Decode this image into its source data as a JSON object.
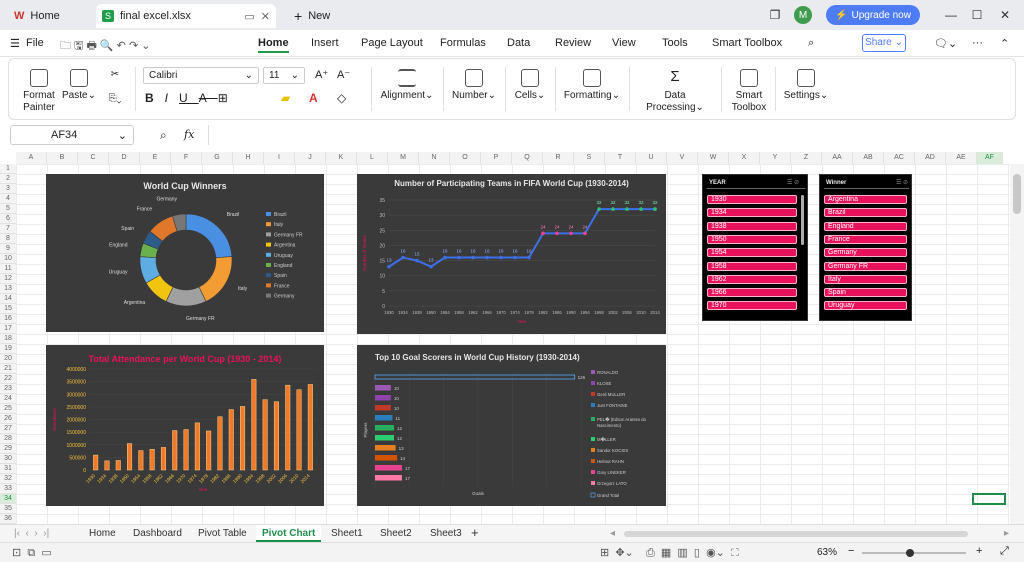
{
  "titlebar": {
    "home_tab": "Home",
    "file_tab": "final excel.xlsx",
    "new_tab": "New",
    "user_initial": "M",
    "upgrade": "Upgrade now"
  },
  "menu": {
    "file": "File",
    "items": [
      "Home",
      "Insert",
      "Page Layout",
      "Formulas",
      "Data",
      "Review",
      "View",
      "Tools",
      "Smart Toolbox"
    ],
    "share": "Share"
  },
  "ribbon": {
    "format_painter": "Format Painter",
    "paste": "Paste",
    "font_name": "Calibri",
    "font_size": "11",
    "alignment": "Alignment",
    "number": "Number",
    "cells": "Cells",
    "formatting": "Formatting",
    "data_processing": "Data Processing",
    "smart_toolbox": "Smart Toolbox",
    "settings": "Settings"
  },
  "formula": {
    "cell_ref": "AF34",
    "fx": "fx",
    "value": ""
  },
  "grid": {
    "columns": [
      "A",
      "B",
      "C",
      "D",
      "E",
      "F",
      "G",
      "H",
      "I",
      "J",
      "K",
      "L",
      "M",
      "N",
      "O",
      "P",
      "Q",
      "R",
      "S",
      "T",
      "U",
      "V",
      "W",
      "X",
      "Y",
      "Z",
      "AA",
      "AB",
      "AC",
      "AD",
      "AE",
      "AF"
    ],
    "rows": [
      "1",
      "2",
      "3",
      "4",
      "5",
      "6",
      "7",
      "8",
      "9",
      "10",
      "11",
      "12",
      "13",
      "14",
      "15",
      "16",
      "17",
      "18",
      "19",
      "20",
      "21",
      "22",
      "23",
      "24",
      "25",
      "26",
      "27",
      "28",
      "29",
      "30",
      "31",
      "32",
      "33",
      "34",
      "35",
      "36"
    ]
  },
  "charts": {
    "donut": {
      "title": "World Cup Winners",
      "chart_data": {
        "type": "pie",
        "categories": [
          "Brazil",
          "Italy",
          "Germany FR",
          "Argentina",
          "Uruguay",
          "England",
          "Spain",
          "France",
          "Germany"
        ],
        "values": [
          5,
          4,
          3,
          2,
          2,
          1,
          1,
          2,
          1
        ],
        "colors": [
          "#4a90e2",
          "#f39c34",
          "#a0a0a0",
          "#f1c40f",
          "#5dade2",
          "#6ab04c",
          "#2e5c8a",
          "#e0782c",
          "#777777"
        ],
        "legend": "right"
      }
    },
    "line": {
      "title": "Number of Participating Teams in FIFA World Cup (1930-2014)",
      "ylabel": "Number of Teams",
      "xlabel": "Year",
      "chart_data": {
        "type": "line",
        "x": [
          "1930",
          "1934",
          "1938",
          "1950",
          "1954",
          "1958",
          "1962",
          "1966",
          "1970",
          "1974",
          "1978",
          "1982",
          "1986",
          "1990",
          "1994",
          "1998",
          "2002",
          "2006",
          "2010",
          "2014"
        ],
        "values": [
          13,
          16,
          15,
          13,
          16,
          16,
          16,
          16,
          16,
          16,
          16,
          24,
          24,
          24,
          24,
          32,
          32,
          32,
          32,
          32
        ],
        "ylim": [
          0,
          35
        ],
        "yticks": [
          "0",
          "5",
          "10",
          "15",
          "20",
          "25",
          "30",
          "35"
        ]
      }
    },
    "bars": {
      "title": "Total Attendance per World Cup (1930 - 2014)",
      "ylabel": "Attendance",
      "xlabel": "Year",
      "chart_data": {
        "type": "bar",
        "categories": [
          "1930",
          "1934",
          "1938",
          "1950",
          "1954",
          "1958",
          "1962",
          "1966",
          "1970",
          "1974",
          "1978",
          "1982",
          "1986",
          "1990",
          "1994",
          "1998",
          "2002",
          "2006",
          "2010",
          "2014"
        ],
        "values": [
          590549,
          363000,
          375700,
          1045246,
          768607,
          819810,
          893172,
          1563135,
          1603975,
          1865753,
          1545791,
          2109723,
          2394031,
          2516215,
          3587538,
          2785100,
          2705197,
          3359439,
          3178856,
          3386810
        ],
        "ylim": [
          0,
          4000000
        ],
        "yticks": [
          "0",
          "500000",
          "1000000",
          "1500000",
          "2000000",
          "2500000",
          "3000000",
          "3500000",
          "4000000"
        ]
      }
    },
    "hbar": {
      "title": "Top 10 Goal Scorers in World Cup History (1930-2014)",
      "ylabel": "Players",
      "xlabel": "Goals",
      "chart_data": {
        "type": "bar",
        "categories": [
          "RONALDO",
          "KLOSE",
          "Gerd MULLER",
          "Just FONTAINE",
          "PEL� (Edson Arantes do Nascimento)",
          "M�LLER",
          "Sandor KOCSIS",
          "Helmut RAHN",
          "Gary LINEKER",
          "Grzegorz LATO"
        ],
        "values": [
          10,
          10,
          10,
          11,
          12,
          12,
          13,
          14,
          17,
          17
        ],
        "grand_total": 126,
        "grand_total_label": "Grand Total",
        "colors": [
          "#9b59b6",
          "#8e44ad",
          "#c0392b",
          "#2980b9",
          "#27ae60",
          "#2ecc71",
          "#e67e22",
          "#d35400",
          "#e84393",
          "#fd79a8"
        ]
      }
    }
  },
  "slicer_year": {
    "title": "YEAR",
    "items": [
      "1930",
      "1934",
      "1938",
      "1950",
      "1954",
      "1958",
      "1962",
      "1966",
      "1970"
    ]
  },
  "slicer_winner": {
    "title": "Winner",
    "items": [
      "Argentina",
      "Brazil",
      "England",
      "France",
      "Germany",
      "Germany FR",
      "Italy",
      "Spain",
      "Uruguay"
    ]
  },
  "sheets": [
    "Home",
    "Dashboard",
    "Pivot Table",
    "Pivot Chart",
    "Sheet1",
    "Sheet2",
    "Sheet3"
  ],
  "status": {
    "zoom": "63%"
  }
}
